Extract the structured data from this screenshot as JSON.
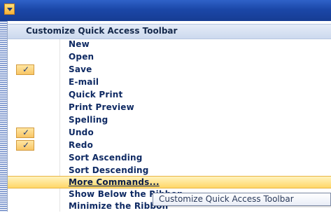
{
  "menu": {
    "header": "Customize Quick Access Toolbar",
    "items": [
      {
        "label": "New",
        "checked": false
      },
      {
        "label": "Open",
        "checked": false
      },
      {
        "label": "Save",
        "checked": true
      },
      {
        "label": "E-mail",
        "checked": false
      },
      {
        "label": "Quick Print",
        "checked": false
      },
      {
        "label": "Print Preview",
        "checked": false
      },
      {
        "label": "Spelling",
        "checked": false
      },
      {
        "label": "Undo",
        "checked": true
      },
      {
        "label": "Redo",
        "checked": true
      },
      {
        "label": "Sort Ascending",
        "checked": false
      },
      {
        "label": "Sort Descending",
        "checked": false
      },
      {
        "label": "More Commands...",
        "checked": false,
        "highlighted": true
      },
      {
        "label": "Show Below the Ribbon",
        "checked": false
      },
      {
        "label": "Minimize the Ribbon",
        "checked": false
      }
    ]
  },
  "tooltip": {
    "text": "Customize Quick Access Toolbar"
  },
  "icons": {
    "qat_dropdown": "chevron-down-icon",
    "check": "checkmark-icon"
  },
  "colors": {
    "titlebar": "#1b47a8",
    "highlight": "#ffd768",
    "item_text": "#0f2a63"
  }
}
